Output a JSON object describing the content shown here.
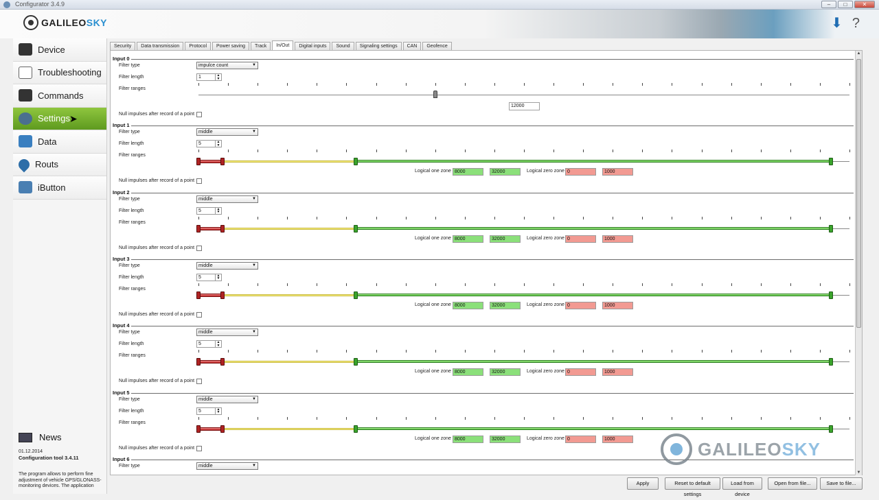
{
  "window": {
    "title": "Configurator 3.4.9",
    "buttons": [
      "–",
      "□",
      "✕"
    ]
  },
  "header": {
    "logo": "GALILEOSKY",
    "icons": [
      "download-icon",
      "help-icon"
    ]
  },
  "sidebar": {
    "items": [
      {
        "label": "Device",
        "icon": "device-icon"
      },
      {
        "label": "Troubleshooting",
        "icon": "chart-icon"
      },
      {
        "label": "Commands",
        "icon": "terminal-icon"
      },
      {
        "label": "Settings",
        "icon": "gear-icon",
        "active": true
      },
      {
        "label": "Data",
        "icon": "database-icon"
      },
      {
        "label": "Routs",
        "icon": "map-pin-icon"
      },
      {
        "label": "iButton",
        "icon": "lock-icon"
      }
    ],
    "news": {
      "label": "News",
      "date": "01.12.2014",
      "title": "Configuration tool 3.4.11",
      "text": "The program allows to perform fine adjustment of vehicle GPS/GLONASS-monitoring devices. The application"
    }
  },
  "tabs": [
    {
      "label": "Security"
    },
    {
      "label": "Data transmission"
    },
    {
      "label": "Protocol"
    },
    {
      "label": "Power saving"
    },
    {
      "label": "Track"
    },
    {
      "label": "In/Out",
      "active": true
    },
    {
      "label": "Digital inputs"
    },
    {
      "label": "Sound"
    },
    {
      "label": "Signaling settings"
    },
    {
      "label": "CAN"
    },
    {
      "label": "Geofence"
    }
  ],
  "labels": {
    "filter_type": "Filter type",
    "filter_length": "Filter length",
    "filter_ranges": "Filter ranges",
    "null_impulses": "Null impulses after record of a point",
    "logical_one": "Logical one zone",
    "logical_zero": "Logical zero zone"
  },
  "inputs": [
    {
      "title": "Input 0",
      "filter_type": "impulce count",
      "filter_length": "1",
      "slider_value": "12000"
    },
    {
      "title": "Input 1",
      "filter_type": "middle",
      "filter_length": "5",
      "one_min": "8000",
      "one_max": "32000",
      "zero_min": "0",
      "zero_max": "1000"
    },
    {
      "title": "Input 2",
      "filter_type": "middle",
      "filter_length": "5",
      "one_min": "8000",
      "one_max": "32000",
      "zero_min": "0",
      "zero_max": "1000"
    },
    {
      "title": "Input 3",
      "filter_type": "middle",
      "filter_length": "5",
      "one_min": "8000",
      "one_max": "32000",
      "zero_min": "0",
      "zero_max": "1000"
    },
    {
      "title": "Input 4",
      "filter_type": "middle",
      "filter_length": "5",
      "one_min": "8000",
      "one_max": "32000",
      "zero_min": "0",
      "zero_max": "1000"
    },
    {
      "title": "Input 5",
      "filter_type": "middle",
      "filter_length": "5",
      "one_min": "8000",
      "one_max": "32000",
      "zero_min": "0",
      "zero_max": "1000"
    },
    {
      "title": "Input 6",
      "filter_type": "middle"
    }
  ],
  "footer": {
    "apply": "Apply",
    "reset": "Reset to default settings",
    "load_device": "Load from device",
    "open_file": "Open from file...",
    "save_file": "Save to file..."
  },
  "watermark": "GALILEOSKY"
}
